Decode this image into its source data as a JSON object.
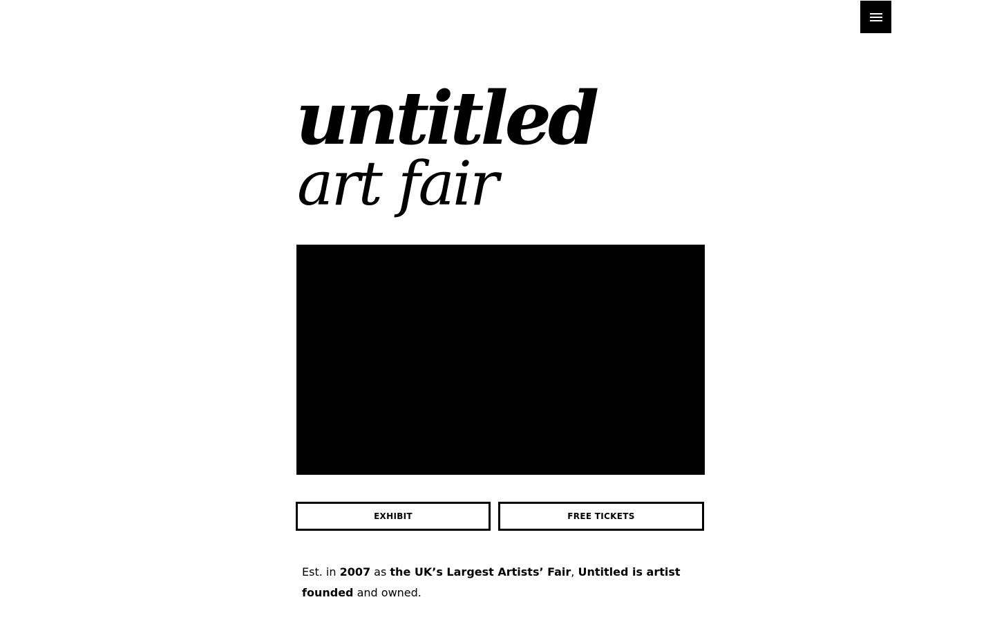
{
  "header": {
    "menu_icon": "hamburger-menu-icon",
    "menu_button_color": "#000000"
  },
  "logo": {
    "line1": "untitled",
    "line2": "art fair"
  },
  "hero": {
    "video_color": "#000000"
  },
  "actions": {
    "exhibit_label": "EXHIBIT",
    "tickets_label": "FREE TICKETS"
  },
  "intro": {
    "p1": "Est. in ",
    "year": "2007",
    "p2": " as ",
    "claim": "the UK’s Largest Artists’ Fair",
    "p3": ", ",
    "founded": "Untitled is artist founded",
    "p4": " and owned."
  }
}
